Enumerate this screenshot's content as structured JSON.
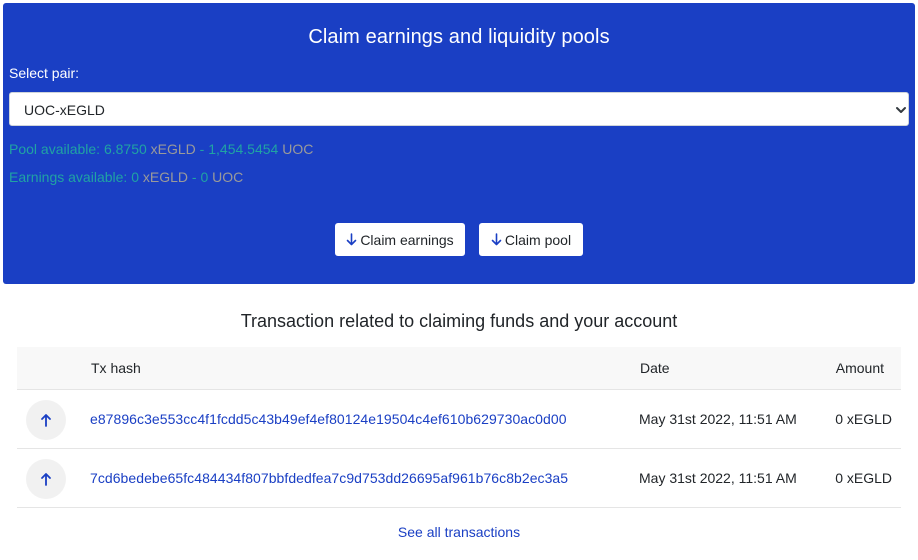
{
  "panel": {
    "title": "Claim earnings and liquidity pools",
    "select_label": "Select pair:",
    "selected_pair": "UOC-xEGLD",
    "pool": {
      "prefix": "Pool available: ",
      "amount1": "6.8750",
      "token1": " xEGLD",
      "sep": " - ",
      "amount2": "1,454.5454",
      "token2": " UOC"
    },
    "earnings": {
      "prefix": "Earnings available: ",
      "amount1": "0",
      "token1": " xEGLD",
      "sep": " - ",
      "amount2": "0",
      "token2": " UOC"
    },
    "claim_earnings_label": "Claim earnings",
    "claim_pool_label": "Claim pool"
  },
  "transactions": {
    "title": "Transaction related to claiming funds and your account",
    "headers": {
      "hash": "Tx hash",
      "date": "Date",
      "amount": "Amount"
    },
    "rows": [
      {
        "hash": "e87896c3e553cc4f1fcdd5c43b49ef4ef80124e19504c4ef610b629730ac0d00",
        "date": "May 31st 2022, 11:51 AM",
        "amount": "0 xEGLD"
      },
      {
        "hash": "7cd6bedebe65fc484434f807bbfdedfea7c9d753dd26695af961b76c8b2ec3a5",
        "date": "May 31st 2022, 11:51 AM",
        "amount": "0 xEGLD"
      }
    ],
    "see_all_label": "See all transactions"
  },
  "colors": {
    "panel_bg": "#1a3fc4",
    "accent_green": "#20a3a3",
    "muted": "#9a9a9a",
    "link": "#1a3fc4"
  }
}
